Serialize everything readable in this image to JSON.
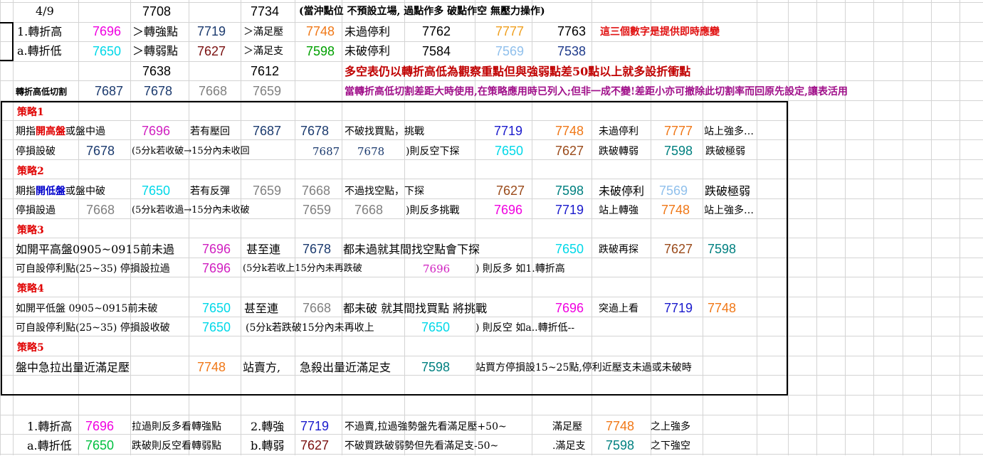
{
  "colors": {
    "magenta": "#f000e0",
    "cyan": "#00d8e8",
    "navy": "#1b3a6e",
    "maroon": "#7a1010",
    "orange": "#f07818",
    "green": "#00a000",
    "gray": "#808080",
    "blue": "#1a1acc",
    "teal": "#008080",
    "brown": "#9a4a1a",
    "gold": "#f0a020",
    "lightblue": "#90c0ec",
    "darkblue": "#1e3a8a",
    "red": "#e01010",
    "redbright": "#e00000",
    "purple": "#a0108a",
    "darkred": "#c00000",
    "bluetext": "#0000cc",
    "violet": "#d020c0"
  },
  "header": {
    "r0": {
      "date": "4/9",
      "v1": "7708",
      "v2": "7734",
      "note": "(當沖點位 不預設立場, 過點作多 破點作空 無壓力操作)"
    },
    "r1": {
      "label": "1.轉折高",
      "v1": "7696",
      "a1": "＞轉強點",
      "v2": "7719",
      "a2": "＞滿足壓",
      "v3": "7748",
      "a3": "未過停利",
      "v4": "7762",
      "v5": "7777",
      "v6": "7763",
      "note": "這三個數字是提供即時應變"
    },
    "r2": {
      "label": "a.轉折低",
      "v1": "7650",
      "a1": "＞轉弱點",
      "v2": "7627",
      "a2": "＞滿足支",
      "v3": "7598",
      "a3": "未破停利",
      "v4": "7584",
      "v5": "7569",
      "v6": "7538"
    },
    "r3": {
      "v1": "7638",
      "v2": "7612",
      "note": "多空表仍以轉折高低為觀察重點但與強弱點差50點以上就多設折衝點"
    },
    "r4": {
      "label": "轉折高低切割",
      "v1": "7687",
      "v2": "7678",
      "v3": "7668",
      "v4": "7659",
      "note": "當轉折高低切割差距大時使用,在策略應用時已列入;但非一成不變!差距小亦可撤除此切割率而回原先設定,讓表活用"
    }
  },
  "strategies": {
    "s1": {
      "title": "策略1",
      "l1": {
        "pre": "期指",
        "hl": "開高盤",
        "post": "或盤中過",
        "v1": "7696",
        "t2": "若有壓回",
        "v2": "7687",
        "v3": "7678",
        "t3": "不破找買點，挑戰",
        "v4": "7719",
        "v5": "7748",
        "t4": "未過停利",
        "v6": "7777",
        "t5": "站上強多…"
      },
      "l2": {
        "t1": "停損設破",
        "v1": "7678",
        "t2": "(5分k若收破→15分內未收回",
        "v2": "7687",
        "v3": "7678",
        "t3": ")則反空下探",
        "v4": "7650",
        "v5": "7627",
        "t4": "跌破轉弱",
        "v6": "7598",
        "t5": "跌破極弱"
      }
    },
    "s2": {
      "title": "策略2",
      "l1": {
        "pre": "期指",
        "hl": "開低盤",
        "post": "或盤中破",
        "v1": "7650",
        "t2": "若有反彈",
        "v2": "7659",
        "v3": "7668",
        "t3": "不過找空點，下探",
        "v4": "7627",
        "v5": "7598",
        "t4": "未破停利",
        "v6": "7569",
        "t5": "跌破極弱"
      },
      "l2": {
        "t1": "停損設過",
        "v1": "7668",
        "t2": "(5分k若收過→15分內未收破",
        "v2": "7659",
        "v3": "7668",
        "t3": ")則反多挑戰",
        "v4": "7696",
        "v5": "7719",
        "t4": "站上轉強",
        "v6": "7748",
        "t5": "站上強多…"
      }
    },
    "s3": {
      "title": "策略3",
      "l1": {
        "t1": "如開平高盤0905~0915前未過",
        "v1": "7696",
        "t2": "甚至連",
        "v2": "7678",
        "t3": "都未過就其間找空點會下探",
        "v3": "7650",
        "t4": "跌破再探",
        "v4": "7627",
        "v5": "7598"
      },
      "l2": {
        "t1": "可自設停利點(25~35) 停損設拉過",
        "v1": "7696",
        "t2": "(5分k若收上15分內未再跌破",
        "v2": "7696",
        "t3": ") 則反多 如1.轉折高"
      }
    },
    "s4": {
      "title": "策略4",
      "l1": {
        "t1": "如開平低盤 0905~0915前未破",
        "v1": "7650",
        "t2": "甚至連",
        "v2": "7668",
        "t3": "都未破 就其間找買點 將挑戰",
        "v3": "7696",
        "t4": "突過上看",
        "v4": "7719",
        "v5": "7748"
      },
      "l2": {
        "t1": "可自設停利點(25~35) 停損設收破",
        "v1": "7650",
        "t2": "(5分k若跌破15分內未再收上",
        "v2": "7650",
        "t3": ") 則反空 如a..轉折低--"
      }
    },
    "s5": {
      "title": "策略5",
      "l1": {
        "t1": "盤中急拉出量近滿足壓",
        "v1": "7748",
        "t2": "站賣方,",
        "t3": "急殺出量近滿足支",
        "v2": "7598",
        "t4": "站買方停損設15~25點,停利近壓支未過或未破時"
      }
    }
  },
  "footer": {
    "r1": {
      "label": "1.轉折高",
      "v1": "7696",
      "t1": "拉過則反多看轉強點",
      "l2": "2.轉強",
      "v2": "7719",
      "t2": "不過賣,拉過強勢盤先看滿足壓+50~",
      "l3": "滿足壓",
      "v3": "7748",
      "t3": "之上強多"
    },
    "r2": {
      "label": "a.轉折低",
      "v1": "7650",
      "t1": "跌破則反空看轉弱點",
      "l2": "b.轉弱",
      "v2": "7627",
      "t2": "不破買跌破弱勢但先看滿足支-50~",
      "l3": ".滿足支",
      "v3": "7598",
      "t3": "之下強空"
    }
  }
}
